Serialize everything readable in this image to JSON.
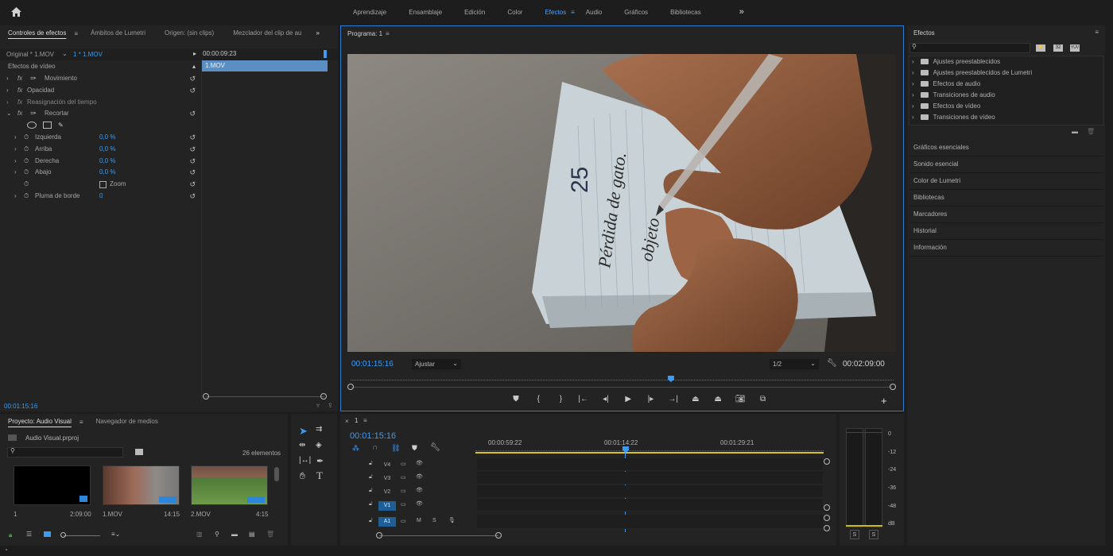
{
  "topbar": {
    "home_icon": "home-icon",
    "workspaces": [
      "Aprendizaje",
      "Ensamblaje",
      "Edición",
      "Color",
      "Efectos",
      "Audio",
      "Gráficos",
      "Bibliotecas"
    ],
    "active_workspace": "Efectos",
    "more": "»"
  },
  "effect_controls": {
    "tabs": [
      "Controles de efectos",
      "Ámbitos de Lumetri",
      "Origen: (sin clips)",
      "Mezclador del clip de au"
    ],
    "source_master": "Original * 1.MOV",
    "source_clip": "1 * 1.MOV",
    "timecode_head": "00:00:09:23",
    "clip_bar": "1.MOV",
    "section": "Efectos de vídeo",
    "effects": [
      "Movimiento",
      "Opacidad",
      "Reasignación del tiempo",
      "Recortar"
    ],
    "params": [
      {
        "label": "Izquierda",
        "value": "0,0 %"
      },
      {
        "label": "Arriba",
        "value": "0,0 %"
      },
      {
        "label": "Derecha",
        "value": "0,0 %"
      },
      {
        "label": "Abajo",
        "value": "0,0 %"
      }
    ],
    "zoom_label": "Zoom",
    "feather_label": "Pluma de borde",
    "feather_value": "0",
    "footer_timecode": "00:01:15:16"
  },
  "program": {
    "title": "Programa: 1",
    "timecode": "00:01:15:16",
    "fit": "Ajustar",
    "resolution": "1/2",
    "duration": "00:02:09:00",
    "playhead_fraction": 0.59,
    "video_text": {
      "number": "25",
      "line1": "Pérdida de gato.",
      "line2": "objeto"
    }
  },
  "project": {
    "tabs": [
      "Proyecto: Audio Visual",
      "Navegador de medios"
    ],
    "file": "Audio Visual.prproj",
    "count": "26 elementos",
    "search_placeholder": "",
    "items": [
      {
        "name": "1",
        "duration": "2:09:00"
      },
      {
        "name": "1.MOV",
        "duration": "14:15"
      },
      {
        "name": "2.MOV",
        "duration": "4:15"
      }
    ]
  },
  "timeline": {
    "seq_name": "1",
    "timecode": "00:01:15:16",
    "ruler": [
      "00:00:59:22",
      "00:01:14:22",
      "00:01:29:21"
    ],
    "tracks": [
      "V4",
      "V3",
      "V2",
      "V1",
      "A1"
    ],
    "track_buttons": {
      "mute": "M",
      "solo": "S"
    }
  },
  "meter": {
    "scale": [
      "0",
      "-12",
      "-24",
      "-36",
      "-48",
      "dB"
    ],
    "solo": [
      "S",
      "S"
    ]
  },
  "effects_panel": {
    "title": "Efectos",
    "folders": [
      "Ajustes preestablecidos",
      "Ajustes preestablecidos de Lumetri",
      "Efectos de audio",
      "Transiciones de audio",
      "Efectos de vídeo",
      "Transiciones de vídeo"
    ],
    "sections": [
      "Gráficos esenciales",
      "Sonido esencial",
      "Color de Lumetri",
      "Bibliotecas",
      "Marcadores",
      "Historial",
      "Información"
    ]
  }
}
